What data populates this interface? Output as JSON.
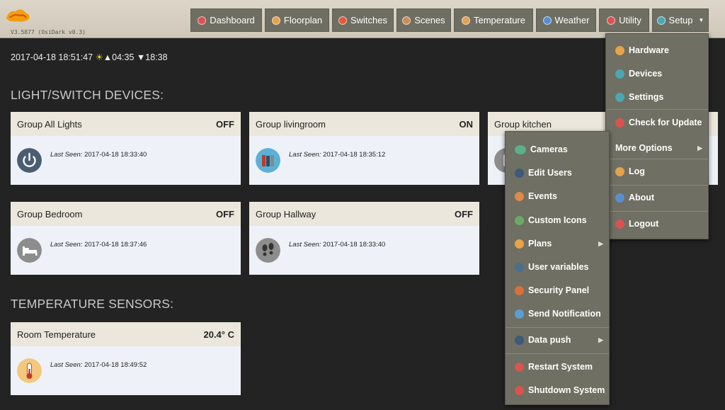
{
  "header": {
    "version": "V3.5877 (OsiDark v0.3)",
    "nav": [
      {
        "label": "Dashboard",
        "color": "#d9534f"
      },
      {
        "label": "Floorplan",
        "color": "#e8a24a"
      },
      {
        "label": "Switches",
        "color": "#e05a3a"
      },
      {
        "label": "Scenes",
        "color": "#c98d5a"
      },
      {
        "label": "Temperature",
        "color": "#e0a050"
      },
      {
        "label": "Weather",
        "color": "#5a8fcf"
      },
      {
        "label": "Utility",
        "color": "#d9534f"
      },
      {
        "label": "Setup",
        "color": "#4aa8b0"
      }
    ]
  },
  "status": {
    "datetime": "2017-04-18 18:51:47",
    "sun_symbol": "☀",
    "sunrise": "▲04:35",
    "sunset": "▼18:38"
  },
  "sections": {
    "lights_title": "LIGHT/SWITCH DEVICES:",
    "temp_title": "TEMPERATURE SENSORS:"
  },
  "cards": [
    {
      "name": "Group All Lights",
      "status": "OFF",
      "seen_label": "Last Seen:",
      "seen": "2017-04-18 18:33:40",
      "icon": "power-icon"
    },
    {
      "name": "Group livingroom",
      "status": "ON",
      "seen_label": "Last Seen:",
      "seen": "2017-04-18 18:35:12",
      "icon": "books-icon"
    },
    {
      "name": "Group kitchen",
      "status": "",
      "seen_label": "",
      "seen": "",
      "icon": "kitchen-icon"
    },
    {
      "name": "Group Bedroom",
      "status": "OFF",
      "seen_label": "Last Seen:",
      "seen": "2017-04-18 18:37:46",
      "icon": "bed-icon"
    },
    {
      "name": "Group Hallway",
      "status": "OFF",
      "seen_label": "Last Seen:",
      "seen": "2017-04-18 18:33:40",
      "icon": "footprints-icon"
    },
    {
      "name": "Room Temperature",
      "status": "20.4° C",
      "seen_label": "Last Seen:",
      "seen": "2017-04-18 18:49:52",
      "icon": "thermometer-icon"
    }
  ],
  "setup_menu": [
    {
      "label": "Hardware",
      "color": "#e8a24a"
    },
    {
      "label": "Devices",
      "color": "#4aa8b0"
    },
    {
      "label": "Settings",
      "color": "#4aa8b0"
    },
    {
      "label": "Check for Update",
      "color": "#d9534f"
    },
    {
      "label": "More Options",
      "color": ""
    },
    {
      "label": "Log",
      "color": "#e8a24a"
    },
    {
      "label": "About",
      "color": "#5a8fcf"
    },
    {
      "label": "Logout",
      "color": "#d9534f"
    }
  ],
  "more_options_menu": [
    {
      "label": "Cameras",
      "color": "#5ab08a"
    },
    {
      "label": "Edit Users",
      "color": "#3d5a7a"
    },
    {
      "label": "Events",
      "color": "#e08a4a"
    },
    {
      "label": "Custom Icons",
      "color": "#6aa86a"
    },
    {
      "label": "Plans",
      "color": "#e8a24a"
    },
    {
      "label": "User variables",
      "color": "#4a6f8f"
    },
    {
      "label": "Security Panel",
      "color": "#d9703a"
    },
    {
      "label": "Send Notification",
      "color": "#5a9fd0"
    },
    {
      "label": "Data push",
      "color": "#3d5a7a"
    },
    {
      "label": "Restart System",
      "color": "#d9534f"
    },
    {
      "label": "Shutdown System",
      "color": "#d9534f"
    }
  ]
}
